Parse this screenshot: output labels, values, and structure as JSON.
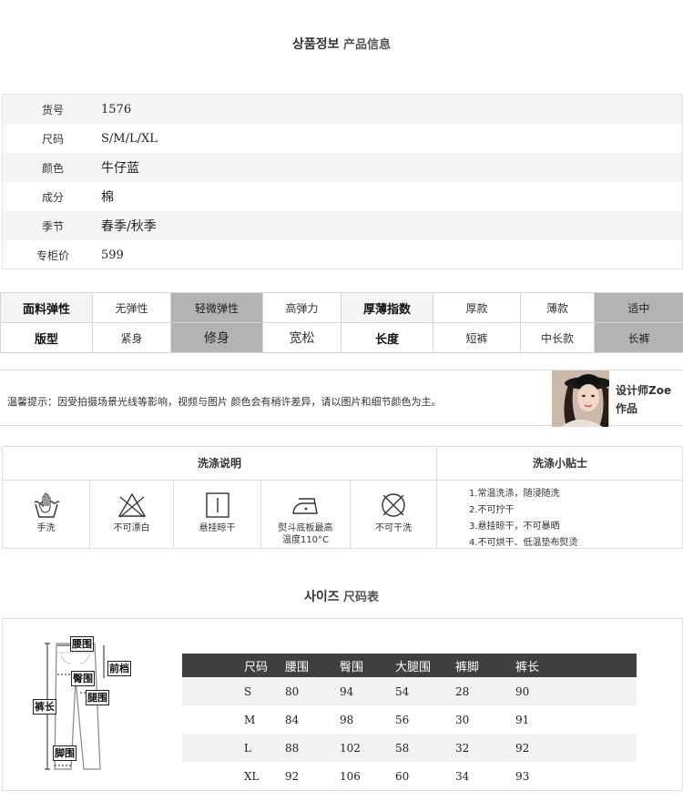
{
  "product_info": {
    "title_kr": "상품정보",
    "title_cn": "产品信息",
    "rows": [
      {
        "label": "货号",
        "value": "1576"
      },
      {
        "label": "尺码",
        "value": "S/M/L/XL"
      },
      {
        "label": "颜色",
        "value": "牛仔蓝"
      },
      {
        "label": "成分",
        "value": "棉"
      },
      {
        "label": "季节",
        "value": "春季/秋季"
      },
      {
        "label": "专柜价",
        "value": "599"
      }
    ]
  },
  "attributes": {
    "row1": {
      "elasticity_label": "面料弹性",
      "elasticity_options": [
        "无弹性",
        "轻微弹性",
        "高弹力"
      ],
      "elasticity_selected": "轻微弹性",
      "thickness_label": "厚薄指数",
      "thickness_options": [
        "厚款",
        "薄款",
        "适中"
      ],
      "thickness_selected": "适中"
    },
    "row2": {
      "fit_label": "版型",
      "fit_options": [
        "紧身",
        "修身",
        "宽松"
      ],
      "fit_selected": "修身",
      "length_label": "长度",
      "length_options": [
        "短裤",
        "中长款",
        "长裤"
      ],
      "length_selected": "长裤"
    }
  },
  "notice": {
    "text": "温馨提示：因受拍摄场景光线等影响，视频与图片  颜色会有稍许差异，请以图片和细节颜色为主。",
    "designer": "设计师Zoe作品"
  },
  "care": {
    "instructions_title": "洗涤说明",
    "tips_title": "洗涤小贴士",
    "icons": [
      {
        "icon": "hand-wash-icon",
        "label": "手洗"
      },
      {
        "icon": "no-bleach-icon",
        "label": "不可漂白"
      },
      {
        "icon": "hang-dry-icon",
        "label": "悬挂晾干"
      },
      {
        "icon": "iron-icon",
        "label": "熨斗底板最高温度110°C"
      },
      {
        "icon": "no-dry-clean-icon",
        "label": "不可干洗"
      }
    ],
    "iron_label_line1": "熨斗底板最高",
    "iron_label_line2": "温度110°C",
    "tips": [
      "1.常温洗涤，随浸随洗",
      "2.不可拧干",
      "3.悬挂晾干，不可暴晒",
      "4.不可烘干、低温垫布熨烫"
    ]
  },
  "size_chart": {
    "title_kr": "사이즈",
    "title_cn": "尺码表",
    "diagram_labels": [
      "腰围",
      "前档",
      "臀围",
      "裤长",
      "腿围",
      "脚围"
    ],
    "headers": [
      "尺码",
      "腰围",
      "臀围",
      "大腿围",
      "裤脚",
      "裤长"
    ],
    "rows": [
      [
        "S",
        "80",
        "94",
        "54",
        "28",
        "90"
      ],
      [
        "M",
        "84",
        "98",
        "56",
        "30",
        "91"
      ],
      [
        "L",
        "88",
        "102",
        "58",
        "32",
        "92"
      ],
      [
        "XL",
        "92",
        "106",
        "60",
        "34",
        "93"
      ]
    ]
  }
}
